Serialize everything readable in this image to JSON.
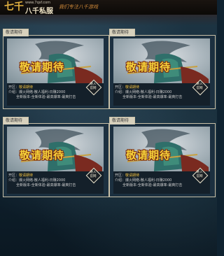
{
  "header": {
    "logo_text": "七千",
    "site_url": "www.7qsf.com",
    "site_name": "八千私服",
    "slogan": "我们专注八千游戏"
  },
  "cards": [
    {
      "tab_label": "敬请期待",
      "title": "敬请期待",
      "server_label": "开区：",
      "server_value": "敬请期待",
      "intro_label": "介绍：",
      "intro_line1": "爆火网络-散人福利-日赚2000",
      "intro_line2": "全新版本-全新体验-最高爆率-最爽打击",
      "enter_line1": "进入",
      "enter_line2": "官网"
    },
    {
      "tab_label": "敬请期待",
      "title": "敬请期待",
      "server_label": "开区：",
      "server_value": "敬请期待",
      "intro_label": "介绍：",
      "intro_line1": "爆火网络-散人福利-日赚2000",
      "intro_line2": "全新版本-全新体验-最高爆率-最爽打击",
      "enter_line1": "进入",
      "enter_line2": "官网"
    },
    {
      "tab_label": "敬请期待",
      "title": "敬请期待",
      "server_label": "开区：",
      "server_value": "敬请期待",
      "intro_label": "介绍：",
      "intro_line1": "爆火网络-散人福利-日赚2000",
      "intro_line2": "全新版本-全新体验-最高爆率-最爽打击",
      "enter_line1": "进入",
      "enter_line2": "官网"
    },
    {
      "tab_label": "敬请期待",
      "title": "敬请期待",
      "server_label": "开区：",
      "server_value": "敬请期待",
      "intro_label": "介绍：",
      "intro_line1": "爆火网络-散人福利-日赚2000",
      "intro_line2": "全新版本-全新体验-最高爆率-最爽打击",
      "enter_line1": "进入",
      "enter_line2": "官网"
    }
  ]
}
